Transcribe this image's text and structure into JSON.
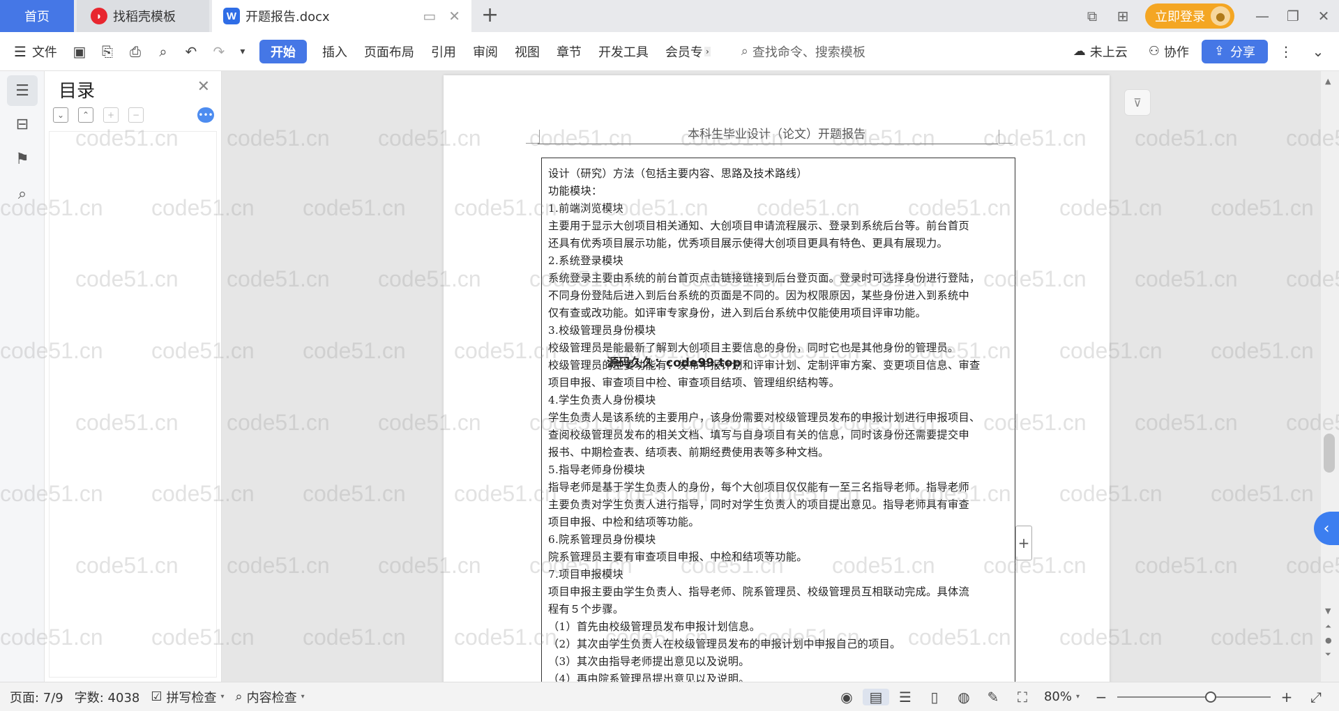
{
  "titlebar": {
    "tabs": [
      {
        "label": "首页"
      },
      {
        "label": "找稻壳模板",
        "icon": "daoke-logo-icon"
      },
      {
        "label": "开题报告.docx",
        "icon": "wps-writer-icon"
      }
    ],
    "new_tab": "+",
    "login_label": "立即登录"
  },
  "toolbar": {
    "menu_label": "文件",
    "tabs": [
      "开始",
      "插入",
      "页面布局",
      "引用",
      "审阅",
      "视图",
      "章节",
      "开发工具",
      "会员专"
    ],
    "search_placeholder": "查找命令、搜索模板",
    "cloud_label": "未上云",
    "collab_label": "协作",
    "share_label": "分享"
  },
  "nav": {
    "title": "目录"
  },
  "document": {
    "running_header": "本科生毕业设计（论文）开题报告",
    "lines": [
      "设计（研究）方法（包括主要内容、思路及技术路线）",
      "功能模块：",
      " 1.前端浏览模块",
      "主要用于显示大创项目相关通知、大创项目申请流程展示、登录到系统后台等。前台首页",
      "还具有优秀项目展示功能，优秀项目展示使得大创项目更具有特色、更具有展现力。",
      "2.系统登录模块",
      "系统登录主要由系统的前台首页点击链接链接到后台登页面。登录时可选择身份进行登陆，",
      "不同身份登陆后进入到后台系统的页面是不同的。因为权限原因，某些身份进入到系统中",
      "仅有查或改功能。如评审专家身份，进入到后台系统中仅能使用项目评审功能。",
      "3.校级管理员身份模块",
      "校级管理员是能最新了解到大创项目主要信息的身份，同时它也是其他身份的管理员。",
      "校级管理员的主要功能有：发布申报计划和评审计划、定制评审方案、变更项目信息、审查",
      "项目申报、审查项目中检、审查项目结项、管理组织结构等。",
      "4.学生负责人身份模块",
      "学生负责人是该系统的主要用户，该身份需要对校级管理员发布的申报计划进行申报项目、",
      "查阅校级管理员发布的相关文档、填写与自身项目有关的信息，同时该身份还需要提交申",
      "报书、中期检查表、结项表、前期经费使用表等多种文档。",
      "5.指导老师身份模块",
      "指导老师是基于学生负责人的身份，每个大创项目仅仅能有一至三名指导老师。指导老师",
      "主要负责对学生负责人进行指导，同时对学生负责人的项目提出意见。指导老师具有审查",
      "项目申报、中检和结项等功能。",
      "6.院系管理员身份模块",
      "院系管理员主要有审查项目申报、中检和结项等功能。",
      "7.项目申报模块",
      "项目申报主要由学生负责人、指导老师、院系管理员、校级管理员互相联动完成。具体流",
      "程有５个步骤。",
      "（1）首先由校级管理员发布申报计划信息。",
      "（2）其次由学生负责人在校级管理员发布的申报计划中申报自己的项目。",
      "（3）其次由指导老师提出意见以及说明。",
      "（4）再由院系管理员提出意见以及说明。"
    ],
    "overlay_text": "源码久久：code99.top",
    "watermark": "code51.cn"
  },
  "statusbar": {
    "page": "页面: 7/9",
    "words": "字数: 4038",
    "spell": "拼写检查",
    "content_check": "内容检查",
    "zoom": "80%",
    "zoom_level": 0.62
  },
  "colors": {
    "accent": "#4577e6",
    "login": "#f4a623"
  }
}
